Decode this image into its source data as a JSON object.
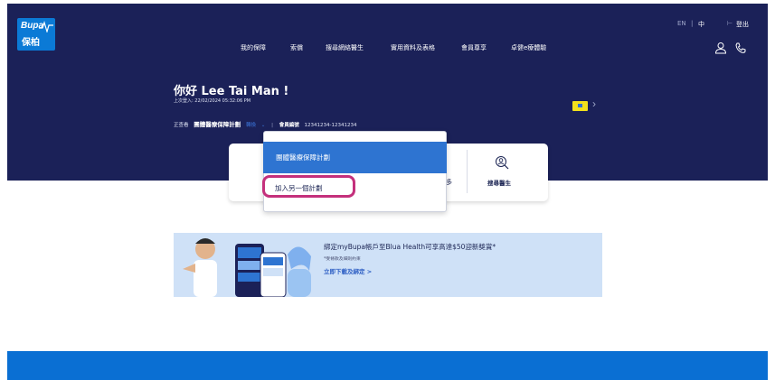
{
  "brand": {
    "logo_en": "Bupa",
    "logo_zh": "保柏"
  },
  "nav": [
    {
      "label": "我的保障"
    },
    {
      "label": "索償"
    },
    {
      "label": "搜尋網絡醫生"
    },
    {
      "label": "實用資料及表格"
    },
    {
      "label": "會員尊享"
    },
    {
      "label": "卓健e療體驗"
    }
  ],
  "topbar": {
    "lang_en": "EN",
    "lang_sep": "|",
    "lang_zh": "中",
    "logout": "登出",
    "logout_icon": "logout-icon"
  },
  "hero": {
    "greeting": "你好 Lee Tai Man !",
    "last_login": "上次登入: 22/02/2024 05:32:06 PM",
    "viewing_label": "正查看",
    "plan_name": "團體醫療保障計劃",
    "switch_label": "轉換",
    "chevron": "⌄",
    "separator": "|",
    "member_label": "會員編號",
    "member_number": "12341234-12341234"
  },
  "quick": {
    "find_doctor": "搜尋醫生",
    "partial_char": "\u0012"
  },
  "dropdown": {
    "selected": "團體醫療保障計劃",
    "add_plan": "加入另一個計劃"
  },
  "promo": {
    "title": "綁定myBupa帳戶至Blua Health可享高達$50迎新獎賞*",
    "note": "*受條款及細則約束",
    "link": "立即下載及綁定 >"
  },
  "colors": {
    "navy": "#1b2158",
    "blue": "#2e74d1",
    "highlight": "#c4307c",
    "footer": "#0a6fd3"
  }
}
